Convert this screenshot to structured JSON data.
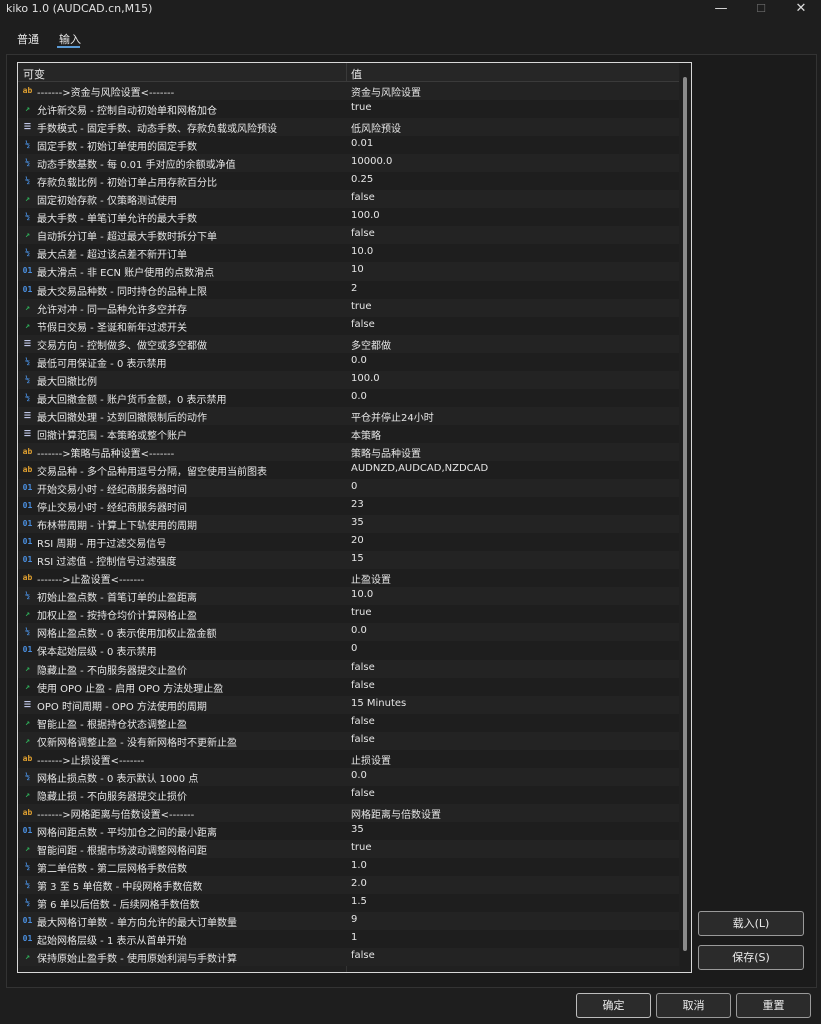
{
  "window": {
    "title": "kiko 1.0 (AUDCAD.cn,M15)",
    "minimize": "—",
    "maximize": "☐",
    "close": "✕"
  },
  "tabs": [
    {
      "label": "普通"
    },
    {
      "label": "输入"
    }
  ],
  "grid": {
    "col_name": "可变",
    "col_value": "值",
    "rows": [
      {
        "icon": "ab",
        "name": "------->资金与风险设置<-------",
        "value": "资金与风险设置"
      },
      {
        "icon": "bool",
        "name": "允许新交易 - 控制自动初始单和网格加仓",
        "value": "true"
      },
      {
        "icon": "list",
        "name": "手数模式 - 固定手数、动态手数、存款负载或风险预设",
        "value": "低风险预设"
      },
      {
        "icon": "half",
        "name": "固定手数 - 初始订单使用的固定手数",
        "value": "0.01"
      },
      {
        "icon": "half",
        "name": "动态手数基数 - 每 0.01 手对应的余额或净值",
        "value": "10000.0"
      },
      {
        "icon": "half",
        "name": "存款负载比例 - 初始订单占用存款百分比",
        "value": "0.25"
      },
      {
        "icon": "bool",
        "name": "固定初始存款 - 仅策略测试使用",
        "value": "false"
      },
      {
        "icon": "half",
        "name": "最大手数 - 单笔订单允许的最大手数",
        "value": "100.0"
      },
      {
        "icon": "bool",
        "name": "自动拆分订单 - 超过最大手数时拆分下单",
        "value": "false"
      },
      {
        "icon": "half",
        "name": "最大点差 - 超过该点差不新开订单",
        "value": "10.0"
      },
      {
        "icon": "num",
        "name": "最大滑点 - 非 ECN 账户使用的点数滑点",
        "value": "10"
      },
      {
        "icon": "num",
        "name": "最大交易品种数 - 同时持仓的品种上限",
        "value": "2"
      },
      {
        "icon": "bool",
        "name": "允许对冲 - 同一品种允许多空并存",
        "value": "true"
      },
      {
        "icon": "bool",
        "name": "节假日交易 - 圣诞和新年过滤开关",
        "value": "false"
      },
      {
        "icon": "list",
        "name": "交易方向 - 控制做多、做空或多空都做",
        "value": "多空都做"
      },
      {
        "icon": "half",
        "name": "最低可用保证金 - 0 表示禁用",
        "value": "0.0"
      },
      {
        "icon": "half",
        "name": "最大回撤比例",
        "value": "100.0"
      },
      {
        "icon": "half",
        "name": "最大回撤金额 - 账户货币金额，0 表示禁用",
        "value": "0.0"
      },
      {
        "icon": "list",
        "name": "最大回撤处理 - 达到回撤限制后的动作",
        "value": "平仓并停止24小时"
      },
      {
        "icon": "list",
        "name": "回撤计算范围 - 本策略或整个账户",
        "value": "本策略"
      },
      {
        "icon": "ab",
        "name": "------->策略与品种设置<-------",
        "value": "策略与品种设置"
      },
      {
        "icon": "ab",
        "name": "交易品种 - 多个品种用逗号分隔，留空使用当前图表",
        "value": "AUDNZD,AUDCAD,NZDCAD"
      },
      {
        "icon": "num",
        "name": "开始交易小时 - 经纪商服务器时间",
        "value": "0"
      },
      {
        "icon": "num",
        "name": "停止交易小时 - 经纪商服务器时间",
        "value": "23"
      },
      {
        "icon": "num",
        "name": "布林带周期 - 计算上下轨使用的周期",
        "value": "35"
      },
      {
        "icon": "num",
        "name": "RSI 周期 - 用于过滤交易信号",
        "value": "20"
      },
      {
        "icon": "num",
        "name": "RSI 过滤值 - 控制信号过滤强度",
        "value": "15"
      },
      {
        "icon": "ab",
        "name": "------->止盈设置<-------",
        "value": "止盈设置"
      },
      {
        "icon": "half",
        "name": "初始止盈点数 - 首笔订单的止盈距离",
        "value": "10.0"
      },
      {
        "icon": "bool",
        "name": "加权止盈 - 按持仓均价计算网格止盈",
        "value": "true"
      },
      {
        "icon": "half",
        "name": "网格止盈点数 - 0 表示使用加权止盈金额",
        "value": "0.0"
      },
      {
        "icon": "num",
        "name": "保本起始层级 - 0 表示禁用",
        "value": "0"
      },
      {
        "icon": "bool",
        "name": "隐藏止盈 - 不向服务器提交止盈价",
        "value": "false"
      },
      {
        "icon": "bool",
        "name": "使用 OPO 止盈 - 启用 OPO 方法处理止盈",
        "value": "false"
      },
      {
        "icon": "list",
        "name": "OPO 时间周期 - OPO 方法使用的周期",
        "value": "15 Minutes"
      },
      {
        "icon": "bool",
        "name": "智能止盈 - 根据持仓状态调整止盈",
        "value": "false"
      },
      {
        "icon": "bool",
        "name": "仅新网格调整止盈 - 没有新网格时不更新止盈",
        "value": "false"
      },
      {
        "icon": "ab",
        "name": "------->止损设置<-------",
        "value": "止损设置"
      },
      {
        "icon": "half",
        "name": "网格止损点数 - 0 表示默认 1000 点",
        "value": "0.0"
      },
      {
        "icon": "bool",
        "name": "隐藏止损 - 不向服务器提交止损价",
        "value": "false"
      },
      {
        "icon": "ab",
        "name": "------->网格距离与倍数设置<-------",
        "value": "网格距离与倍数设置"
      },
      {
        "icon": "num",
        "name": "网格间距点数 - 平均加仓之间的最小距离",
        "value": "35"
      },
      {
        "icon": "bool",
        "name": "智能间距 - 根据市场波动调整网格间距",
        "value": "true"
      },
      {
        "icon": "half",
        "name": "第二单倍数 - 第二层网格手数倍数",
        "value": "1.0"
      },
      {
        "icon": "half",
        "name": "第 3 至 5 单倍数 - 中段网格手数倍数",
        "value": "2.0"
      },
      {
        "icon": "half",
        "name": "第 6 单以后倍数 - 后续网格手数倍数",
        "value": "1.5"
      },
      {
        "icon": "num",
        "name": "最大网格订单数 - 单方向允许的最大订单数量",
        "value": "9"
      },
      {
        "icon": "num",
        "name": "起始网格层级 - 1 表示从首单开始",
        "value": "1"
      },
      {
        "icon": "bool",
        "name": "保持原始止盈手数 - 使用原始利润与手数计算",
        "value": "false"
      }
    ]
  },
  "icons": {
    "ab": "ab",
    "num": "01",
    "half": "½",
    "list": "☰",
    "bool": "↗"
  },
  "side_buttons": {
    "load": "载入(L)",
    "save": "保存(S)"
  },
  "bottom_buttons": {
    "ok": "确定",
    "cancel": "取消",
    "reset": "重置"
  }
}
